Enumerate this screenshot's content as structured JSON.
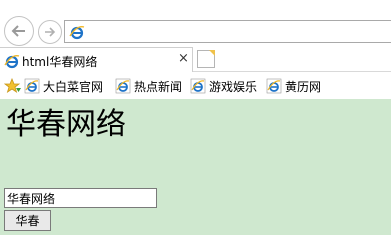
{
  "browser": {
    "back_icon": "back-arrow-icon",
    "forward_icon": "forward-arrow-icon",
    "address_value": "",
    "tab": {
      "title": "html华春网络",
      "close": "×"
    },
    "new_tab_icon": "new-tab-icon"
  },
  "favorites": {
    "items": [
      {
        "label": "大白菜官网"
      },
      {
        "label": "热点新闻"
      },
      {
        "label": "游戏娱乐"
      },
      {
        "label": "黄历网"
      }
    ]
  },
  "page": {
    "heading": "华春网络",
    "input_value": "华春网络",
    "button_label": "华春",
    "background": "#cfe8cf"
  },
  "colors": {
    "ie_blue": "#1e73c8",
    "ie_ring": "#f1b828",
    "star": "#f2c12e"
  }
}
